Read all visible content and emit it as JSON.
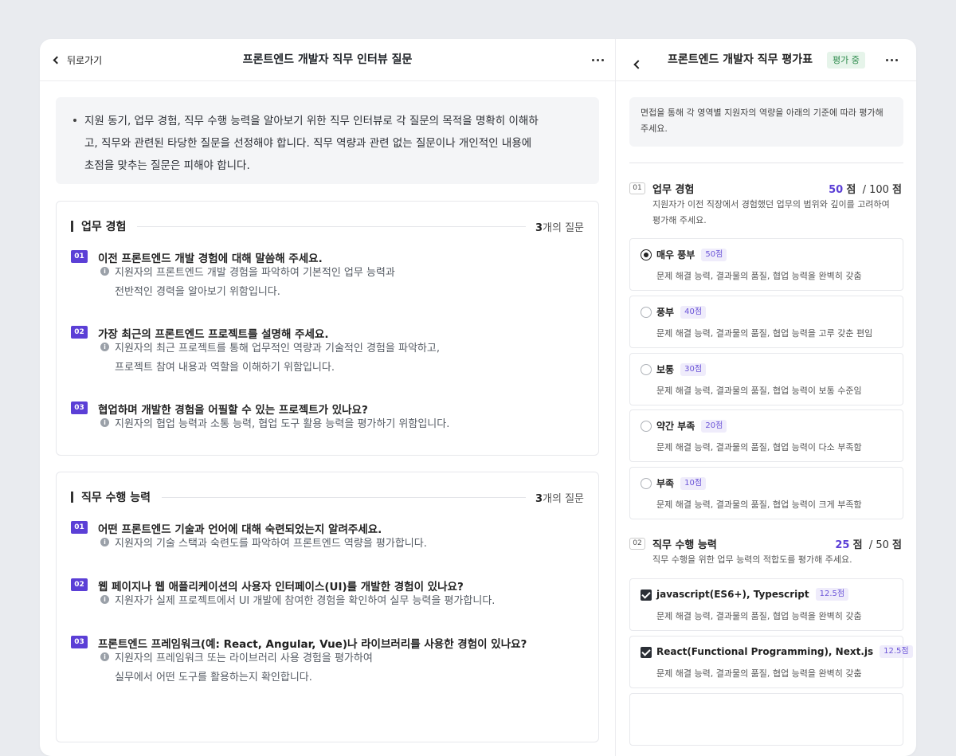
{
  "interview": {
    "back_label": "뒤로가기",
    "title": "프론트엔드 개발자 직무 인터뷰 질문",
    "guide_line1": "지원 동기, 업무 경험, 직무 수행 능력을 알아보기 위한 직무 인터뷰로 각 질문의 목적을 명확히 이해하",
    "guide_line2": "고, 직무와 관련된 타당한 질문을 선정해야 합니다. 직무 역량과 관련 없는 질문이나 개인적인 내용에",
    "guide_line3": "초점을 맞추는 질문은 피해야 합니다.",
    "sections": [
      {
        "title": "업무 경험",
        "count": "3",
        "count_suffix": "개의 질문",
        "questions": [
          {
            "num": "01",
            "text": "이전 프론트엔드 개발 경험에 대해 말씀해 주세요.",
            "desc1": "지원자의 프론트엔드 개발 경험을 파악하여 기본적인 업무 능력과",
            "desc2": "전반적인 경력을 알아보기 위함입니다."
          },
          {
            "num": "02",
            "text": "가장 최근의 프론트엔드 프로젝트를 설명해 주세요.",
            "desc1": "지원자의 최근 프로젝트를 통해 업무적인 역량과 기술적인 경험을 파악하고,",
            "desc2": "프로젝트 참여 내용과 역할을 이해하기 위함입니다."
          },
          {
            "num": "03",
            "text": "협업하며 개발한 경험을 어필할 수 있는 프로젝트가 있나요?",
            "desc1": "지원자의 협업 능력과 소통 능력, 협업 도구 활용 능력을 평가하기 위함입니다.",
            "desc2": ""
          }
        ]
      },
      {
        "title": "직무 수행 능력",
        "count": "3",
        "count_suffix": "개의 질문",
        "questions": [
          {
            "num": "01",
            "text": "어떤 프론트엔드 기술과 언어에 대해 숙련되었는지 알려주세요.",
            "desc1": "지원자의 기술 스택과 숙련도를 파악하여 프론트엔드 역량을 평가합니다.",
            "desc2": ""
          },
          {
            "num": "02",
            "text": "웹 페이지나 웹 애플리케이션의 사용자 인터페이스(UI)를 개발한 경험이 있나요?",
            "desc1": "지원자가 실제 프로젝트에서 UI 개발에 참여한 경험을 확인하여 실무 능력을 평가합니다.",
            "desc2": ""
          },
          {
            "num": "03",
            "text": "프론트엔드 프레임워크(예: React, Angular, Vue)나 라이브러리를 사용한 경험이 있나요?",
            "desc1": "지원자의 프레임워크 또는 라이브러리  사용 경험을 평가하여",
            "desc2": "실무에서 어떤 도구를 활용하는지 확인합니다."
          }
        ]
      }
    ]
  },
  "evaluation": {
    "title": "프론트엔드 개발자 직무 평가표",
    "status_badge": "평가 중",
    "guide_line1": "면접을 통해 각 영역별 지원자의 역량을 아래의 기준에 따라 평가해",
    "guide_line2": "주세요.",
    "criteria": [
      {
        "num": "01",
        "title": "업무 경험",
        "score": "50",
        "score_unit": "점",
        "max": "/ 100",
        "max_unit": "점",
        "desc1": "지원자가 이전 직장에서 경험했던 업무의 범위와 깊이를 고려하여",
        "desc2": "평가해 주세요.",
        "options": [
          {
            "label": "매우 풍부",
            "points": "50점",
            "desc": "문제 해결 능력, 결과물의 품질, 협업 능력을 완벽히 갖춤",
            "selected": true
          },
          {
            "label": "풍부",
            "points": "40점",
            "desc": "문제 해결 능력, 결과물의 품질, 협업 능력을 고루 갖춘 편임",
            "selected": false
          },
          {
            "label": "보통",
            "points": "30점",
            "desc": "문제 해결 능력, 결과물의 품질, 협업 능력이 보통 수준임",
            "selected": false
          },
          {
            "label": "약간 부족",
            "points": "20점",
            "desc": "문제 해결 능력, 결과물의 품질, 협업 능력이 다소 부족함",
            "selected": false
          },
          {
            "label": "부족",
            "points": "10점",
            "desc": "문제 해결 능력, 결과물의 품질, 협업 능력이 크게 부족함",
            "selected": false
          }
        ]
      },
      {
        "num": "02",
        "title": "직무 수행 능력",
        "score": "25",
        "score_unit": "점",
        "max": "/ 50",
        "max_unit": "점",
        "desc1": "직무 수행을 위한 업무 능력의 적합도를 평가해 주세요.",
        "options": [
          {
            "label": "javascript(ES6+), Typescript",
            "points": "12.5점",
            "desc": "문제 해결 능력, 결과물의 품질, 협업 능력을 완벽히 갖춤",
            "checked": true
          },
          {
            "label": "React(Functional Programming), Next.js",
            "points": "12.5점",
            "desc": "문제 해결 능력, 결과물의 품질, 협업 능력을 완벽히 갖춤",
            "checked": true
          }
        ]
      }
    ]
  },
  "colors": {
    "accent": "#5b3fd6",
    "badge_green": "#2c8a4b",
    "page_bg": "#e9ebef"
  }
}
